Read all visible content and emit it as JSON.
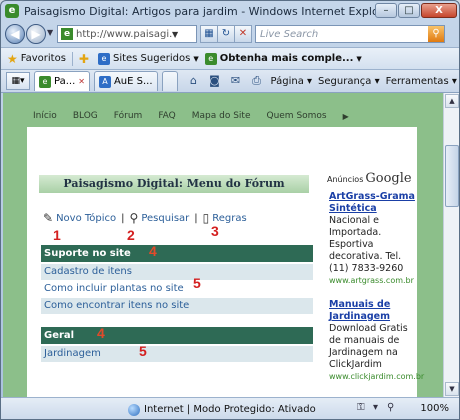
{
  "window": {
    "title": "Paisagismo Digital: Artigos para jardim - Windows Internet Explorer",
    "minimize": "–",
    "maximize": "□",
    "close": "X"
  },
  "address": {
    "url": "http://www.paisagi...",
    "search_placeholder": "Live Search"
  },
  "favorites_bar": {
    "favorites": "Favoritos",
    "suggested": "Sites Sugeridos",
    "more": "Obtenha mais comple..."
  },
  "tabs": [
    {
      "label": "Pa..."
    },
    {
      "label": "AuE S..."
    }
  ],
  "commands": {
    "page": "Página",
    "security": "Segurança",
    "tools": "Ferramentas"
  },
  "site_nav": [
    "Início",
    "BLOG",
    "Fórum",
    "FAQ",
    "Mapa do Site",
    "Quem Somos"
  ],
  "forum": {
    "header": "Paisagismo Digital: Menu do Fórum",
    "actions": {
      "new_topic": "Novo Tópico",
      "search": "Pesquisar",
      "rules": "Regras"
    },
    "sections": [
      {
        "title": "Suporte no site",
        "items": [
          "Cadastro de itens",
          "Como incluir plantas no site",
          "Como encontrar itens no site"
        ]
      },
      {
        "title": "Geral",
        "items": [
          "Jardinagem"
        ]
      }
    ]
  },
  "annotations": [
    "1",
    "2",
    "3",
    "4",
    "5",
    "4",
    "5"
  ],
  "ads": {
    "label": "Anúncios",
    "brand": "Google",
    "items": [
      {
        "title": "ArtGrass-Grama Sintética",
        "text": "Nacional e Importada. Esportiva decorativa. Tel.(11) 7833-9260",
        "url": "www.artgrass.com.br"
      },
      {
        "title": "Manuais de Jardinagem",
        "text": "Download Gratis de manuais de Jardinagem na ClickJardim",
        "url": "www.clickjardim.com.br"
      }
    ]
  },
  "status": {
    "zone": "Internet | Modo Protegido: Ativado",
    "zoom": "100%"
  }
}
